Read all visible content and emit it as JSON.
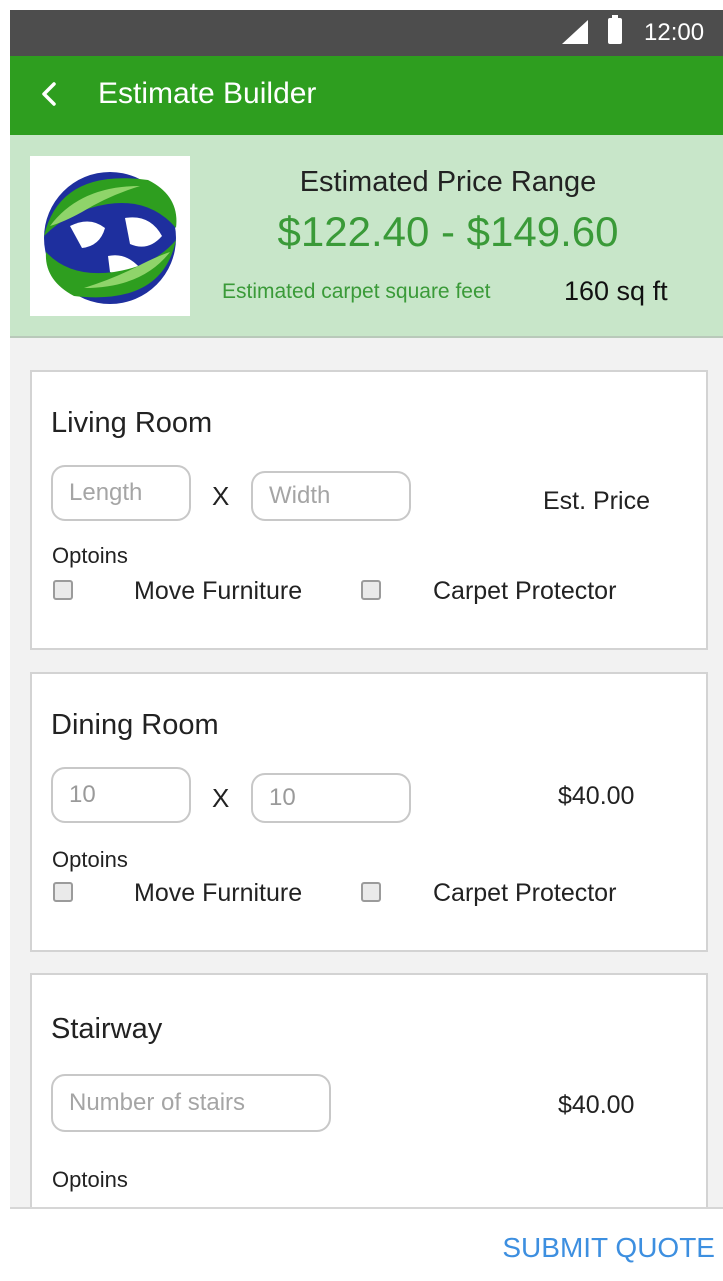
{
  "status_bar": {
    "time": "12:00"
  },
  "app_bar": {
    "title": "Estimate Builder"
  },
  "summary": {
    "range_label": "Estimated Price Range",
    "range_value": "$122.40 - $149.60",
    "sqft_label": "Estimated carpet square feet",
    "sqft_value": "160 sq ft"
  },
  "rooms": [
    {
      "title": "Living Room",
      "length_placeholder": "Length",
      "length_value": "",
      "times": "X",
      "width_placeholder": "Width",
      "width_value": "",
      "price": "Est. Price",
      "options_label": "Optoins",
      "options": [
        "Move Furniture",
        "Carpet Protector"
      ]
    },
    {
      "title": "Dining Room",
      "length_placeholder": "",
      "length_value": "10",
      "times": "X",
      "width_placeholder": "",
      "width_value": "10",
      "price": "$40.00",
      "options_label": "Optoins",
      "options": [
        "Move Furniture",
        "Carpet Protector"
      ]
    },
    {
      "title": "Stairway",
      "stairs_placeholder": "Number of stairs",
      "stairs_value": "",
      "price": "$40.00",
      "options_label": "Optoins"
    }
  ],
  "bottom_bar": {
    "submit_label": "SUBMIT QUOTE"
  },
  "colors": {
    "app_bar": "#2e9e1f",
    "summary_bg": "#c8e6c9",
    "price_green": "#3a9a38",
    "submit_blue": "#3d8fe0"
  },
  "icons": {
    "back": "chevron-left-icon",
    "signal": "signal-icon",
    "battery": "battery-icon",
    "logo": "globe-leaf-logo"
  }
}
